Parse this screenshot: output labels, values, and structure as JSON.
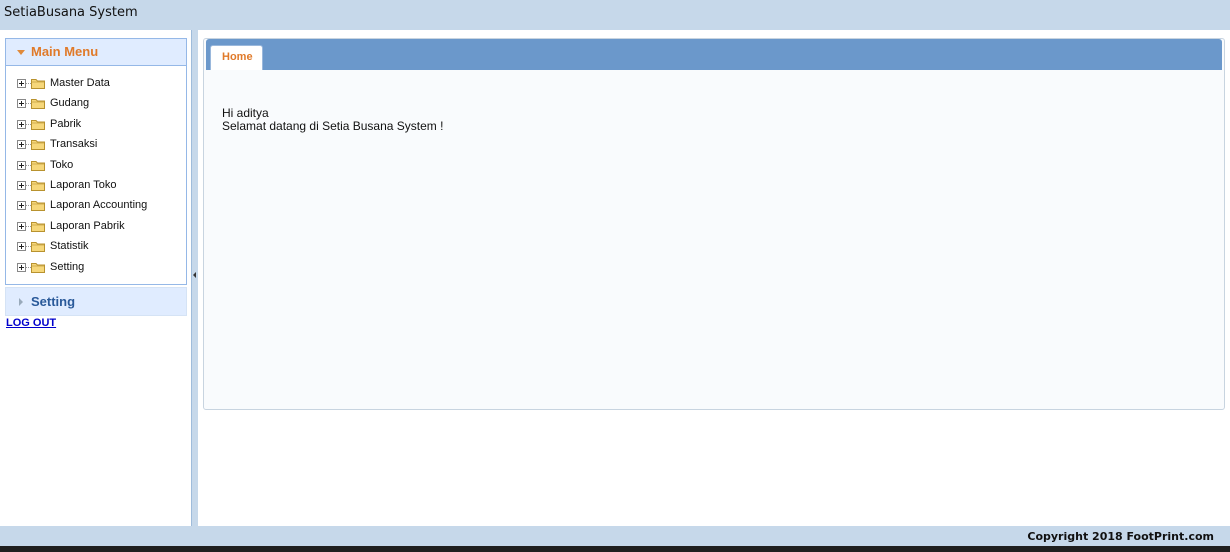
{
  "header": {
    "title": "SetiaBusana System"
  },
  "sidebar": {
    "main_menu_title": "Main Menu",
    "items": [
      {
        "label": "Master Data"
      },
      {
        "label": "Gudang"
      },
      {
        "label": "Pabrik"
      },
      {
        "label": "Transaksi"
      },
      {
        "label": "Toko"
      },
      {
        "label": "Laporan Toko"
      },
      {
        "label": "Laporan Accounting"
      },
      {
        "label": "Laporan Pabrik"
      },
      {
        "label": "Statistik"
      },
      {
        "label": "Setting"
      }
    ],
    "setting_title": "Setting",
    "logout_label": "LOG OUT"
  },
  "main": {
    "tabs": [
      {
        "label": "Home"
      }
    ],
    "greeting": "Hi aditya",
    "welcome": "Selamat datang di Setia Busana System !"
  },
  "footer": {
    "copyright": "Copyright 2018 FootPrint.com"
  },
  "colors": {
    "header_bg": "#c6d8ea",
    "tab_strip": "#6b98cb",
    "accent_orange": "#e07a2a",
    "link_blue": "#0000cc"
  },
  "icons": {
    "expand": "plus-box-icon",
    "folder": "folder-icon",
    "collapse_caret": "caret-down-icon",
    "expand_caret": "caret-right-icon",
    "splitter": "collapse-arrow-icon"
  }
}
